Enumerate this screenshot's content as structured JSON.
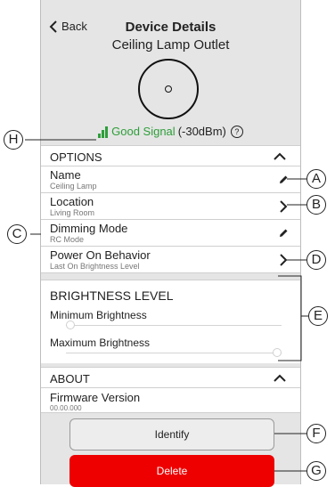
{
  "header": {
    "back_label": "Back",
    "title": "Device Details",
    "subtitle": "Ceiling Lamp Outlet"
  },
  "signal": {
    "status": "Good Signal",
    "value": "(-30dBm)",
    "help": "?"
  },
  "options": {
    "title": "OPTIONS",
    "items": [
      {
        "label": "Name",
        "value": "Ceiling Lamp",
        "icon": "pencil-icon"
      },
      {
        "label": "Location",
        "value": "Living Room",
        "icon": "chevron-right-icon"
      },
      {
        "label": "Dimming Mode",
        "value": "RC Mode",
        "icon": "pencil-icon"
      },
      {
        "label": "Power On Behavior",
        "value": "Last On Brightness Level",
        "icon": "chevron-right-icon"
      }
    ]
  },
  "brightness": {
    "title": "BRIGHTNESS LEVEL",
    "min_label": "Minimum Brightness",
    "min_value": 0,
    "max_label": "Maximum Brightness",
    "max_value": 100
  },
  "about": {
    "title": "ABOUT",
    "firmware_label": "Firmware Version",
    "firmware_value": "00.00.000"
  },
  "buttons": {
    "identify": "Identify",
    "delete": "Delete"
  },
  "callouts": {
    "A": "A",
    "B": "B",
    "C": "C",
    "D": "D",
    "E": "E",
    "F": "F",
    "G": "G",
    "H": "H"
  },
  "colors": {
    "signal_green": "#2e9e3a",
    "delete_red": "#ee0000"
  }
}
